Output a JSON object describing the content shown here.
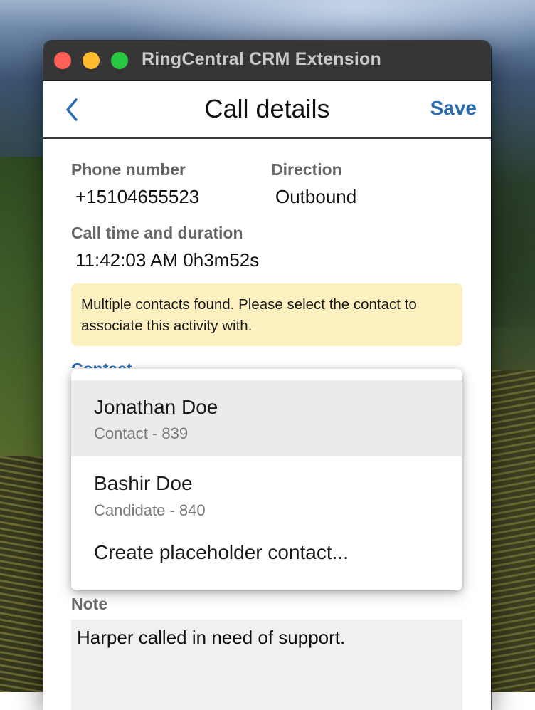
{
  "window": {
    "title": "RingCentral CRM Extension"
  },
  "header": {
    "title": "Call details",
    "save_label": "Save"
  },
  "fields": {
    "phone_label": "Phone number",
    "phone_value": "+15104655523",
    "direction_label": "Direction",
    "direction_value": "Outbound",
    "time_label": "Call time and duration",
    "time_value": "11:42:03 AM 0h3m52s"
  },
  "warning": {
    "text": "Multiple contacts found. Please select the contact to associate this activity with."
  },
  "contact": {
    "label": "Contact",
    "options": [
      {
        "name": "Jonathan Doe",
        "detail": "Contact - 839",
        "highlighted": true
      },
      {
        "name": "Bashir Doe",
        "detail": "Candidate - 840",
        "highlighted": false
      },
      {
        "name": "Create placeholder contact..."
      }
    ]
  },
  "note": {
    "label": "Note",
    "value": "Harper called in need of support."
  },
  "colors": {
    "accent": "#2a6bb1",
    "warning_bg": "#fcf0c0",
    "titlebar": "#363636",
    "highlight": "#ebebeb"
  },
  "icons": {
    "back": "chevron-left-icon"
  }
}
